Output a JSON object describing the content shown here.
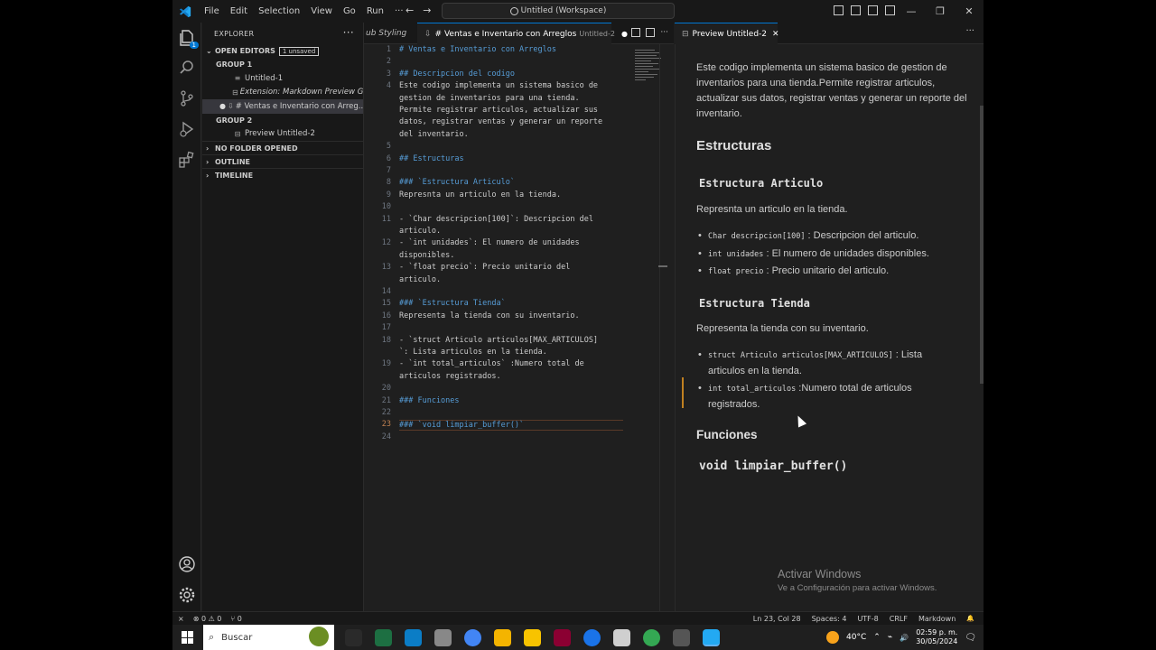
{
  "titlebar": {
    "menu": [
      "File",
      "Edit",
      "Selection",
      "View",
      "Go",
      "Run",
      "···"
    ],
    "command_center": "Untitled (Workspace)",
    "win_min": "—",
    "win_restore": "❐",
    "win_close": "✕"
  },
  "activity": {
    "explorer_badge": "1"
  },
  "sidebar": {
    "title": "EXPLORER",
    "more": "···",
    "open_editors": "OPEN EDITORS",
    "unsaved_badge": "1 unsaved",
    "group1": "GROUP 1",
    "group1_items": [
      "Untitled-1",
      "Extension: Markdown Preview Gi...",
      "# Ventas e Inventario con Arreg..."
    ],
    "group2": "GROUP 2",
    "group2_items": [
      "Preview Untitled-2"
    ],
    "no_folder": "NO FOLDER OPENED",
    "outline": "OUTLINE",
    "timeline": "TIMELINE"
  },
  "tabs": {
    "partial_tab": "ub Styling",
    "active_tab": "# Ventas e Inventario con Arreglos",
    "active_tab_desc": "Untitled-2",
    "preview_tab": "Preview Untitled-2",
    "dot": "●",
    "close": "✕",
    "more": "···"
  },
  "editor": {
    "lines": [
      {
        "n": "1",
        "text": "# Ventas e Inventario con Arreglos",
        "h": true
      },
      {
        "n": "2",
        "text": "",
        "h": false
      },
      {
        "n": "3",
        "text": "## Descripcion del codigo",
        "h": true
      },
      {
        "n": "4",
        "text": "Este codigo implementa un sistema basico de",
        "h": false
      },
      {
        "n": "",
        "text": "gestion de inventarios para una tienda.",
        "h": false
      },
      {
        "n": "",
        "text": "Permite registrar articulos, actualizar sus",
        "h": false
      },
      {
        "n": "",
        "text": "datos, registrar ventas y generar un reporte",
        "h": false
      },
      {
        "n": "",
        "text": "del inventario.",
        "h": false
      },
      {
        "n": "5",
        "text": "",
        "h": false
      },
      {
        "n": "6",
        "text": "## Estructuras",
        "h": true
      },
      {
        "n": "7",
        "text": "",
        "h": false
      },
      {
        "n": "8",
        "text": "### `Estructura Articulo`",
        "h": true
      },
      {
        "n": "9",
        "text": "Represnta un articulo en la tienda.",
        "h": false
      },
      {
        "n": "10",
        "text": "",
        "h": false
      },
      {
        "n": "11",
        "text": "- `Char descripcion[100]`: Descripcion del",
        "h": false
      },
      {
        "n": "",
        "text": "articulo.",
        "h": false
      },
      {
        "n": "12",
        "text": "- `int unidades`: El numero de unidades",
        "h": false
      },
      {
        "n": "",
        "text": "disponibles.",
        "h": false
      },
      {
        "n": "13",
        "text": "- `float precio`: Precio unitario del",
        "h": false
      },
      {
        "n": "",
        "text": "articulo.",
        "h": false
      },
      {
        "n": "14",
        "text": "",
        "h": false
      },
      {
        "n": "15",
        "text": "### `Estructura Tienda`",
        "h": true
      },
      {
        "n": "16",
        "text": "Representa la tienda con su inventario.",
        "h": false
      },
      {
        "n": "17",
        "text": "",
        "h": false
      },
      {
        "n": "18",
        "text": "- `struct Articulo articulos[MAX_ARTICULOS]",
        "h": false
      },
      {
        "n": "",
        "text": "`: Lista articulos en la tienda.",
        "h": false
      },
      {
        "n": "19",
        "text": "- `int total_articulos` :Numero total de",
        "h": false
      },
      {
        "n": "",
        "text": "articulos registrados.",
        "h": false
      },
      {
        "n": "20",
        "text": "",
        "h": false
      },
      {
        "n": "21",
        "text": "### Funciones",
        "h": true
      },
      {
        "n": "22",
        "text": "",
        "h": false
      },
      {
        "n": "23",
        "text": "### `void limpiar_buffer()`",
        "h": true
      },
      {
        "n": "24",
        "text": "",
        "h": false
      }
    ],
    "current_line_index": 31
  },
  "preview": {
    "intro": "Este codigo implementa un sistema basico de gestion de inventarios para una tienda.Permite registrar articulos, actualizar sus datos, registrar ventas y generar un reporte del inventario.",
    "h_estructuras": "Estructuras",
    "h_articulo": "Estructura Articulo",
    "p_articulo": "Represnta un articulo en la tienda.",
    "li1_code": "Char descripcion[100]",
    "li1_text": " : Descripcion del articulo.",
    "li2_code": "int unidades",
    "li2_text": " : El numero de unidades disponibles.",
    "li3_code": "float precio",
    "li3_text": " : Precio unitario del articulo.",
    "h_tienda": "Estructura Tienda",
    "p_tienda": "Representa la tienda con su inventario.",
    "li4_code": "struct Articulo articulos[MAX_ARTICULOS]",
    "li4_text": " : Lista articulos en la tienda.",
    "li5_code": "int total_articulos",
    "li5_text": " :Numero total de articulos registrados.",
    "h_funciones": "Funciones",
    "h_limpiar": "void limpiar_buffer()",
    "activate_title": "Activar Windows",
    "activate_sub": "Ve a Configuración para activar Windows."
  },
  "statusbar": {
    "remote": "⨯",
    "problems": "⊗ 0 ⚠ 0",
    "ports": "⑂ 0",
    "position": "Ln 23, Col 28",
    "spaces": "Spaces: 4",
    "encoding": "UTF-8",
    "eol": "CRLF",
    "language": "Markdown",
    "bell": "🔔"
  },
  "taskbar": {
    "search": "Buscar",
    "temperature": "40°C",
    "time": "02:59 p. m.",
    "date": "30/05/2024",
    "tray_chevron": "⌃",
    "network_icon": "⌁",
    "volume_icon": "🔊",
    "notification_icon": "🗨",
    "app_colors": [
      "#2a2a2a",
      "#1d6f42",
      "#0b7dc6",
      "#888888",
      "#4285f4",
      "#f4b400",
      "#f8c300",
      "#8b0032",
      "#1a73e8",
      "#cfcfcf",
      "#34a853",
      "#555555",
      "#23a9f2"
    ]
  }
}
